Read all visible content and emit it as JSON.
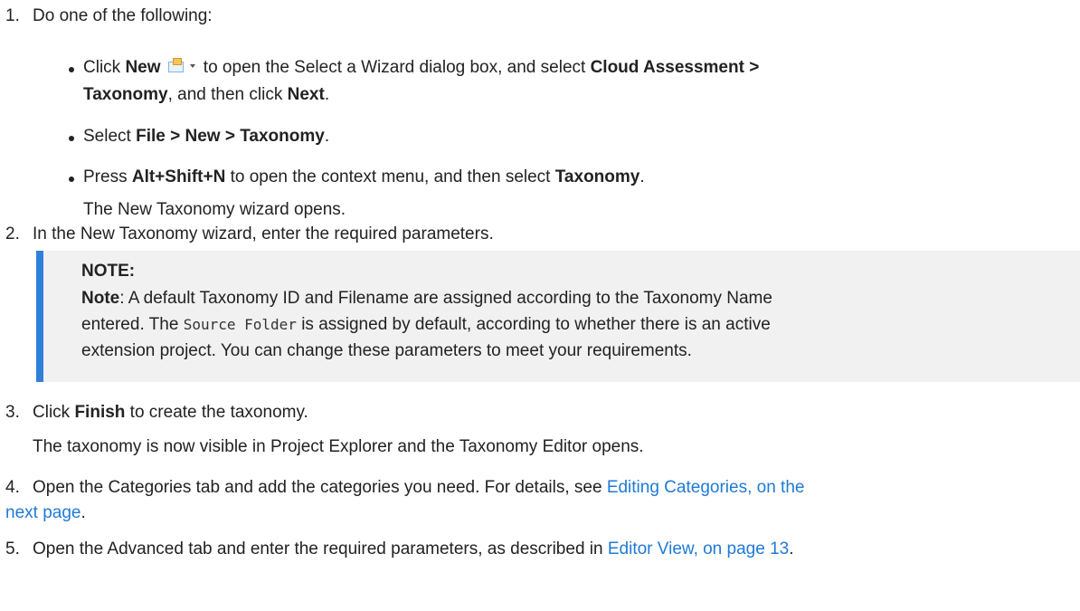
{
  "steps": [
    {
      "num": "1.",
      "text": "Do one of the following:"
    },
    {
      "num": "2.",
      "text": "In the New Taxonomy wizard, enter the required parameters."
    },
    {
      "num": "3.",
      "pre": "Click ",
      "bold": "Finish",
      "post": " to create the taxonomy."
    },
    {
      "num": "4.",
      "text_a": "Open the Categories tab and add the categories you need. For details, see ",
      "link_a": "Editing Categories, on the",
      "link_b": "next page",
      "tail": "."
    },
    {
      "num": "5.",
      "text": "Open the Advanced tab and enter the required parameters, as described in ",
      "link": "Editor View, on page 13",
      "tail": "."
    }
  ],
  "bullets": [
    {
      "a1": "Click ",
      "b1": "New",
      "a2": " to open the Select a Wizard dialog box, and select ",
      "b2": "Cloud Assessment >",
      "b3": "Taxonomy",
      "a3": ", and then click ",
      "b4": "Next",
      "a4": "."
    },
    {
      "a1": "Select ",
      "b1": "File > New > Taxonomy",
      "a2": "."
    },
    {
      "a1": "Press ",
      "b1": "Alt+Shift+N",
      "a2": " to open the context menu, and then select ",
      "b2": "Taxonomy",
      "a3": "."
    }
  ],
  "after_bullets": "The New Taxonomy wizard opens.",
  "after_step3": "The taxonomy is now visible in Project Explorer and the Taxonomy Editor opens.",
  "note": {
    "heading": "NOTE:",
    "label": "Note",
    "line1": ": A default Taxonomy ID and Filename are assigned according to the Taxonomy Name",
    "line2a": "entered. The ",
    "code": "Source Folder",
    "line2b": " is assigned by default, according to whether there is an active",
    "line3": "extension project. You can change these parameters to meet your requirements."
  },
  "icons": {
    "new": "new-wizard-icon"
  },
  "colors": {
    "link": "#1f7ad6",
    "note_bar": "#2f80d8",
    "note_bg": "#f1f1f1"
  }
}
